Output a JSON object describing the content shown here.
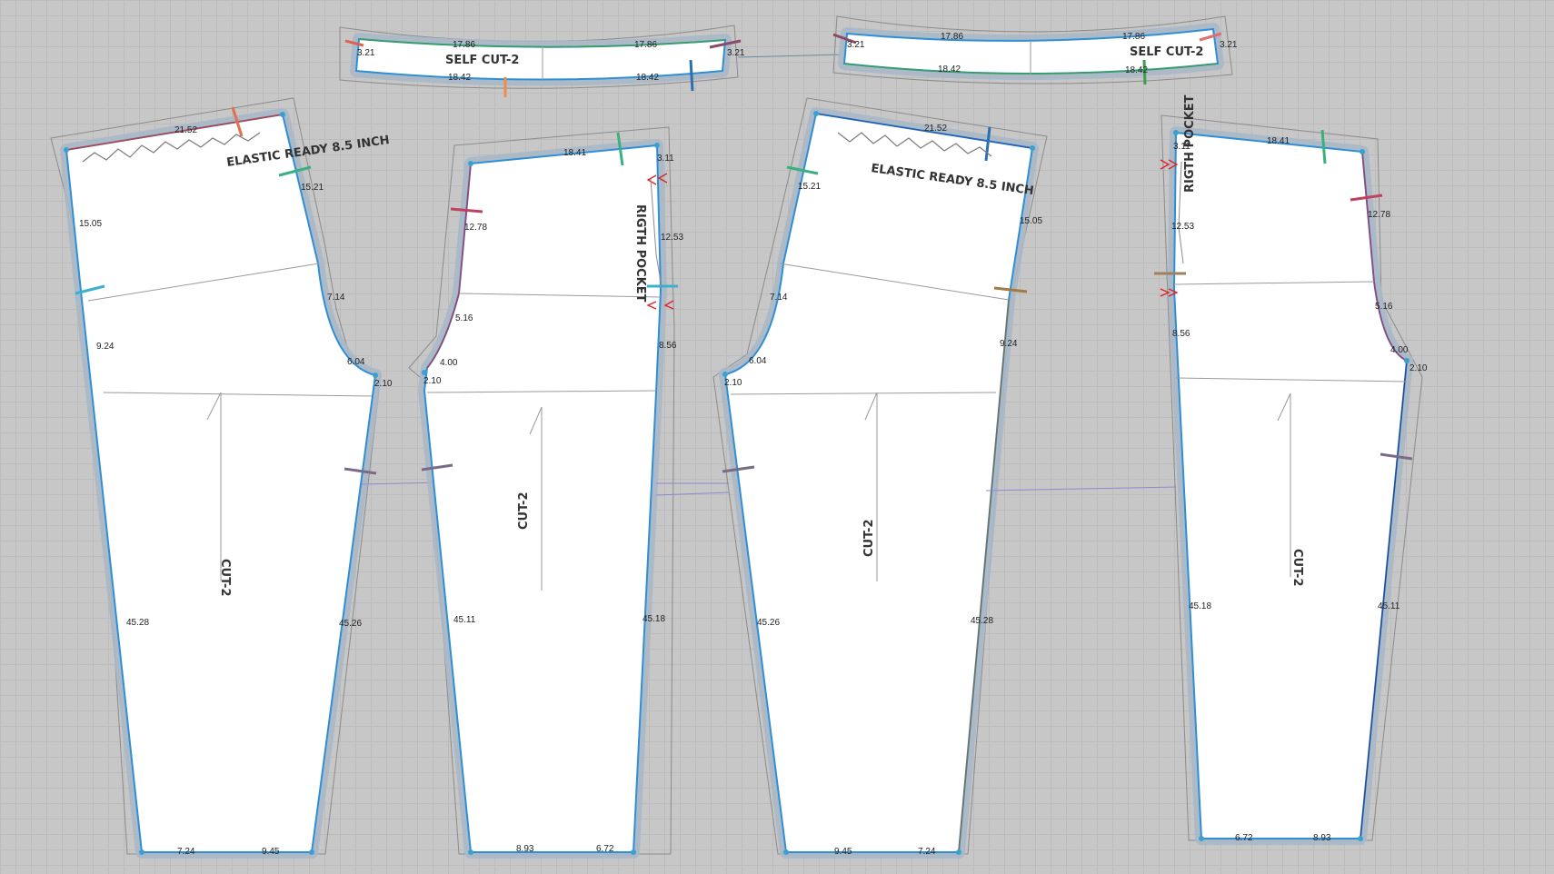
{
  "waistbands": [
    {
      "label": "SELF CUT-2",
      "top_left": "17.86",
      "top_right": "17.86",
      "bottom_left": "18.42",
      "bottom_right": "18.42",
      "end_left": "3.21",
      "end_right": "3.21"
    },
    {
      "label": "SELF CUT-2",
      "top_left": "17.86",
      "top_right": "17.86",
      "bottom_left": "18.42",
      "bottom_right": "18.42",
      "end_left": "3.21",
      "end_right": "3.21"
    }
  ],
  "pieces": [
    {
      "cut": "CUT-2",
      "note": "ELASTIC  READY 8.5 INCH",
      "waist": "21.52",
      "side_top": "15.05",
      "side_mid": "9.24",
      "side_low": "45.28",
      "inner_top": "15.21",
      "inner_mid": "7.14",
      "crotch": "6.04",
      "crotch_tip": "2.10",
      "inseam": "45.26",
      "hem_left": "7.24",
      "hem_right": "9.45"
    },
    {
      "cut": "CUT-2",
      "pocket": "RIGTH POCKET",
      "waist": "18.41",
      "corner": "3.11",
      "pocket_depth": "12.53",
      "side_top": "12.78",
      "side_mid": "5.16",
      "crotch": "4.00",
      "crotch_tip": "2.10",
      "right_mid": "8.56",
      "inseam": "45.11",
      "outseam": "45.18",
      "hem_left": "8.93",
      "hem_right": "6.72"
    },
    {
      "cut": "CUT-2",
      "note": "ELASTIC  READY 8.5 INCH",
      "waist": "21.52",
      "inner_top": "15.21",
      "inner_mid": "7.14",
      "crotch": "6.04",
      "crotch_tip": "2.10",
      "side_top": "15.05",
      "side_mid": "9.24",
      "inseam": "45.26",
      "outseam": "45.28",
      "hem_left": "9.45",
      "hem_right": "7.24"
    },
    {
      "cut": "CUT-2",
      "pocket": "RIGTH POCKET",
      "waist": "18.41",
      "corner": "3.11",
      "pocket_depth": "12.53",
      "side_top": "12.78",
      "side_mid": "5.16",
      "crotch": "4.00",
      "crotch_tip": "2.10",
      "left_mid": "8.56",
      "outseam": "45.18",
      "inseam": "45.11",
      "hem_left": "6.72",
      "hem_right": "8.93"
    }
  ],
  "colors": {
    "canvas": "#c7c7c7",
    "seam_allowance": "#a8b8c8",
    "outline": "#2f8fd6",
    "fabric": "#ffffff"
  }
}
